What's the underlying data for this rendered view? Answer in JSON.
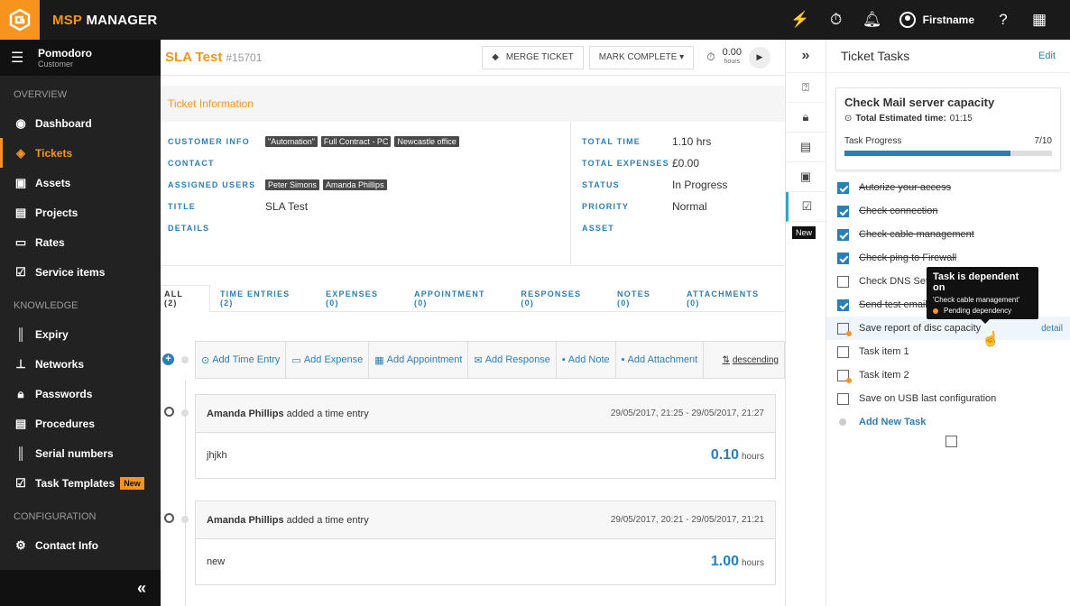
{
  "app": {
    "brand_accent": "MSP",
    "brand_rest": " MANAGER",
    "accent_color": "#f7941d"
  },
  "topbar": {
    "user_name": "Firstname",
    "icons": [
      "broom-icon",
      "timer-icon",
      "bell-icon",
      "user-icon",
      "help-icon",
      "grid-icon"
    ]
  },
  "sidebar": {
    "head_title": "Pomodoro",
    "head_sub": "Customer",
    "section_overview": "OVERVIEW",
    "overview_items": [
      "Dashboard",
      "Tickets",
      "Assets",
      "Projects",
      "Rates",
      "Service items"
    ],
    "section_knowledge": "KNOWLEDGE",
    "knowledge_items": [
      "Expiry",
      "Networks",
      "Passwords",
      "Procedures",
      "Serial numbers",
      "Task Templates"
    ],
    "new_badge": "New",
    "section_config": "CONFIGURATION",
    "config_items": [
      "Contact Info"
    ],
    "collapse_glyph": "«"
  },
  "ticket": {
    "title": "SLA Test",
    "number": "#15701",
    "merge_label": "MERGE TICKET",
    "complete_label": "MARK COMPLETE ▾",
    "timer_value": "0.00",
    "timer_unit": "hours",
    "info_heading": "Ticket Information",
    "labels": {
      "customer_info": "CUSTOMER INFO",
      "contact": "CONTACT",
      "assigned": "ASSIGNED USERS",
      "title": "TITLE",
      "details": "DETAILS",
      "total_time": "TOTAL TIME",
      "total_expenses": "TOTAL EXPENSES",
      "status": "STATUS",
      "priority": "PRIORITY",
      "asset": "ASSET"
    },
    "customer_tags": [
      "\"Automation\"",
      "Full Contract - PC",
      "Newcastle office"
    ],
    "assigned_users": [
      "Peter Simons",
      "Amanda Phillips"
    ],
    "title_value": "SLA Test",
    "total_time": "1.10 hrs",
    "total_expenses": "£0.00",
    "status": "In Progress",
    "priority": "Normal"
  },
  "tabs": [
    "ALL (2)",
    "TIME ENTRIES (2)",
    "EXPENSES (0)",
    "APPOINTMENT (0)",
    "RESPONSES (0)",
    "NOTES (0)",
    "ATTACHMENTS (0)"
  ],
  "actions": [
    "Add Time Entry",
    "Add Expense",
    "Add Appointment",
    "Add Response",
    "Add Note",
    "Add Attachment",
    "descending"
  ],
  "entries": [
    {
      "author": "Amanda Phillips",
      "action": "added a time entry",
      "date": "29/05/2017, 21:25 - 29/05/2017, 21:27",
      "body": "jhjkh",
      "hours": "0.10",
      "unit": "hours"
    },
    {
      "author": "Amanda Phillips",
      "action": "added a time entry",
      "date": "29/05/2017, 20:21 - 29/05/2017, 21:21",
      "body": "new",
      "hours": "1.00",
      "unit": "hours"
    }
  ],
  "iconcol": {
    "collapse_glyph": "»",
    "new_flag": "New"
  },
  "tasks_panel": {
    "title": "Ticket Tasks",
    "edit_label": "Edit",
    "card_title": "Check Mail server capacity",
    "est_label": "Total Estimated time:",
    "est_value": "01:15",
    "progress_label": "Task Progress",
    "progress_text": "7/10",
    "progress_fraction": 0.8,
    "tasks": [
      {
        "label": "Autorize your access",
        "done": true
      },
      {
        "label": "Check connection",
        "done": true
      },
      {
        "label": "Check cable management",
        "done": true
      },
      {
        "label": "Check ping to Firewall",
        "done": true
      },
      {
        "label": "Check DNS Sett",
        "done": false
      },
      {
        "label": "Send test email",
        "done": true
      },
      {
        "label": "Save report of disc capacity",
        "done": false
      },
      {
        "label": "Task item 1",
        "done": false
      },
      {
        "label": "Task item 2",
        "done": false
      },
      {
        "label": "Save on USB last configuration",
        "done": false
      }
    ],
    "detail_label": "detail",
    "add_new": "Add New Task",
    "tooltip_title": "Task is dependent on",
    "tooltip_dep": "'Check cable management'",
    "tooltip_status": "Pending dependency"
  }
}
